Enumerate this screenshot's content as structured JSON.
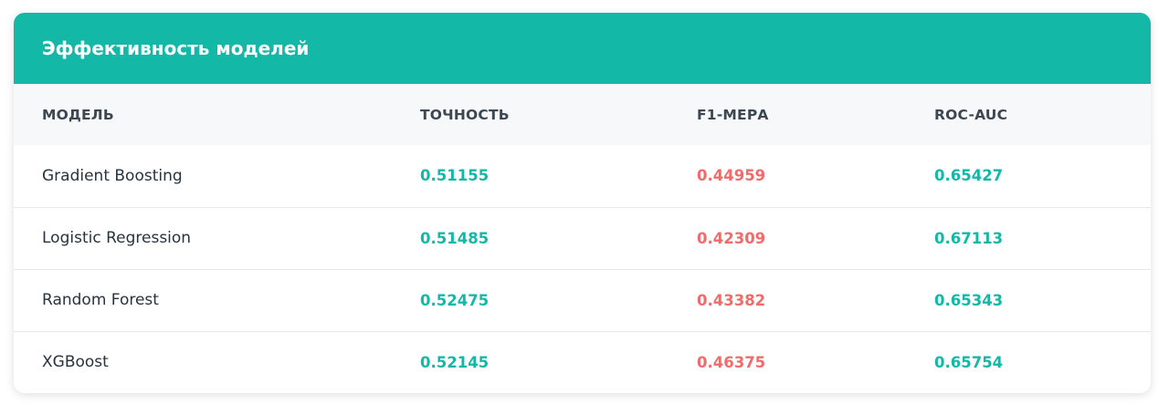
{
  "card": {
    "title": "Эффективность моделей"
  },
  "table": {
    "headers": [
      "МОДЕЛЬ",
      "ТОЧНОСТЬ",
      "F1-МЕРА",
      "ROC-AUC"
    ],
    "rows": [
      {
        "model": "Gradient Boosting",
        "accuracy": "0.51155",
        "f1": "0.44959",
        "roc_auc": "0.65427"
      },
      {
        "model": "Logistic Regression",
        "accuracy": "0.51485",
        "f1": "0.42309",
        "roc_auc": "0.67113"
      },
      {
        "model": "Random Forest",
        "accuracy": "0.52475",
        "f1": "0.43382",
        "roc_auc": "0.65343"
      },
      {
        "model": "XGBoost",
        "accuracy": "0.52145",
        "f1": "0.46375",
        "roc_auc": "0.65754"
      }
    ]
  },
  "colors": {
    "accent": "#14b8a6",
    "negative": "#f26b6b",
    "header_bg": "#f7f8fa"
  }
}
